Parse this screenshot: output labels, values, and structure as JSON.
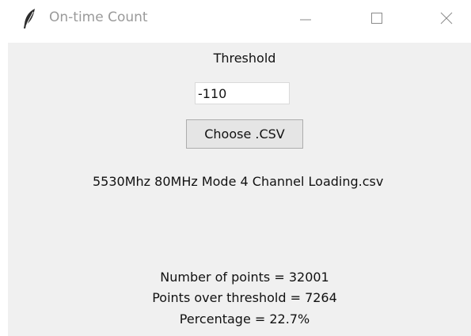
{
  "window": {
    "title": "On-time Count",
    "icon": "feather-icon",
    "controls": [
      "minimize-icon",
      "maximize-icon",
      "close-icon"
    ]
  },
  "form": {
    "threshold_label": "Threshold",
    "threshold_value": "-110",
    "choose_button_label": "Choose .CSV"
  },
  "file": {
    "name": "5530Mhz 80MHz Mode 4 Channel Loading.csv"
  },
  "results": {
    "points_text": "Number of points = 32001",
    "over_threshold_text": "Points over threshold = 7264",
    "percentage_text": "Percentage = 22.7%"
  }
}
